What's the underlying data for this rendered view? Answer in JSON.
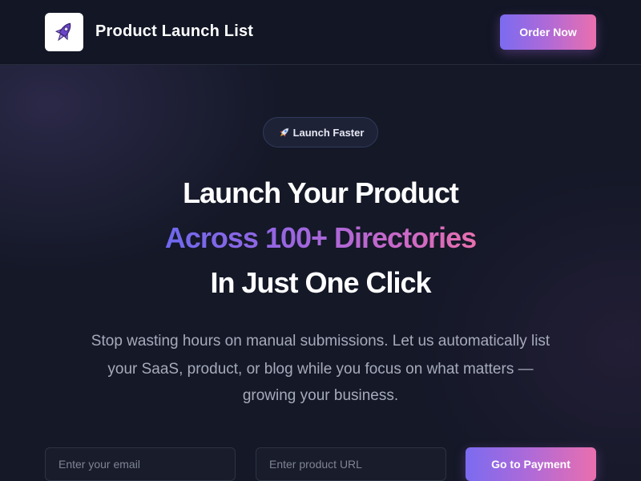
{
  "header": {
    "logo_icon": "rocket-icon",
    "brand": "Product Launch List",
    "order_button": "Order Now"
  },
  "hero": {
    "badge_icon": "rocket-emoji",
    "badge_label": "Launch Faster",
    "headline_line1": "Launch Your Product",
    "headline_line2": "Across 100+ Directories",
    "headline_line3": "In Just One Click",
    "description_line1": "Stop wasting hours on manual submissions. Let us automatically list",
    "description_line2": "your SaaS, product, or blog while you focus on what matters —",
    "description_line3": "growing your business."
  },
  "form": {
    "email_placeholder": "Enter your email",
    "email_value": "",
    "url_placeholder": "Enter product URL",
    "url_value": "",
    "submit_label": "Go to Payment"
  },
  "colors": {
    "background": "#141827",
    "gradient_start": "#7b6bf0",
    "gradient_end": "#ea6fae",
    "muted_text": "#a6abbb"
  }
}
